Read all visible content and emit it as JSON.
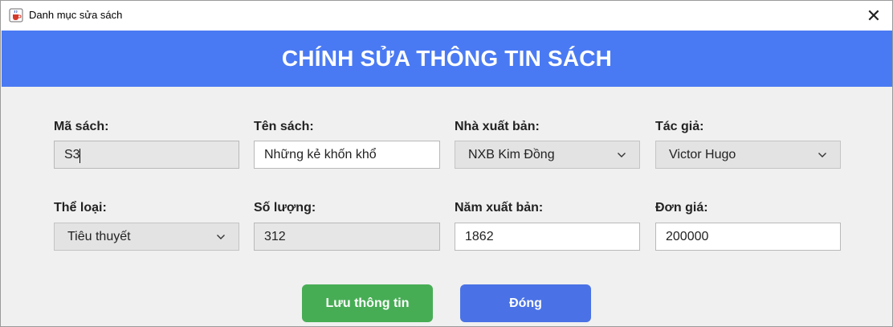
{
  "window": {
    "title": "Danh mục sửa sách",
    "close_glyph": "✕"
  },
  "header": {
    "title": "CHÍNH SỬA THÔNG TIN SÁCH"
  },
  "form": {
    "ma_sach": {
      "label": "Mã sách:",
      "value": "S3"
    },
    "ten_sach": {
      "label": "Tên sách:",
      "value": "Những kẻ khốn khổ"
    },
    "nha_xuat_ban": {
      "label": "Nhà xuất bản:",
      "value": "NXB Kim Đồng"
    },
    "tac_gia": {
      "label": "Tác giả:",
      "value": "Victor Hugo"
    },
    "the_loai": {
      "label": "Thể loại:",
      "value": "Tiêu thuyết"
    },
    "so_luong": {
      "label": "Số lượng:",
      "value": "312"
    },
    "nam_xuat_ban": {
      "label": "Năm xuất bản:",
      "value": "1862"
    },
    "don_gia": {
      "label": "Đơn giá:",
      "value": "200000"
    }
  },
  "buttons": {
    "save_label": "Lưu thông tin",
    "close_label": "Đóng"
  },
  "icons": {
    "app": "java-coffee-icon",
    "close": "close-icon",
    "dropdown": "chevron-down-icon"
  },
  "colors": {
    "header": "#4a7af3",
    "save_button": "#47ad55",
    "close_button": "#4a72e6"
  }
}
